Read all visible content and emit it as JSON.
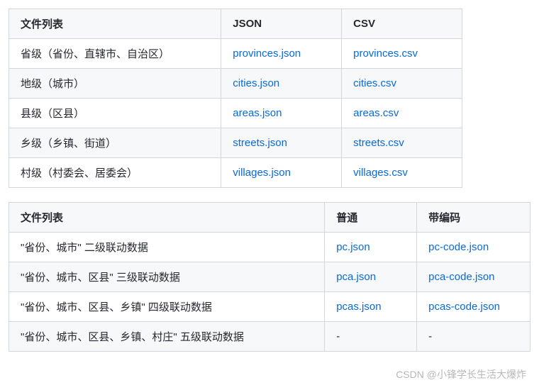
{
  "table1": {
    "headers": [
      "文件列表",
      "JSON",
      "CSV"
    ],
    "rows": [
      {
        "name": "省级（省份、直辖市、自治区）",
        "json": "provinces.json",
        "csv": "provinces.csv"
      },
      {
        "name": "地级（城市）",
        "json": "cities.json",
        "csv": "cities.csv"
      },
      {
        "name": "县级（区县）",
        "json": "areas.json",
        "csv": "areas.csv"
      },
      {
        "name": "乡级（乡镇、街道）",
        "json": "streets.json",
        "csv": "streets.csv"
      },
      {
        "name": "村级（村委会、居委会）",
        "json": "villages.json",
        "csv": "villages.csv"
      }
    ]
  },
  "table2": {
    "headers": [
      "文件列表",
      "普通",
      "带编码"
    ],
    "rows": [
      {
        "name": "\"省份、城市\" 二级联动数据",
        "plain": "pc.json",
        "code": "pc-code.json"
      },
      {
        "name": "\"省份、城市、区县\" 三级联动数据",
        "plain": "pca.json",
        "code": "pca-code.json"
      },
      {
        "name": "\"省份、城市、区县、乡镇\" 四级联动数据",
        "plain": "pcas.json",
        "code": "pcas-code.json"
      },
      {
        "name": "\"省份、城市、区县、乡镇、村庄\" 五级联动数据",
        "plain": "-",
        "code": "-"
      }
    ]
  },
  "watermark": "CSDN @小锋学长生活大爆炸"
}
